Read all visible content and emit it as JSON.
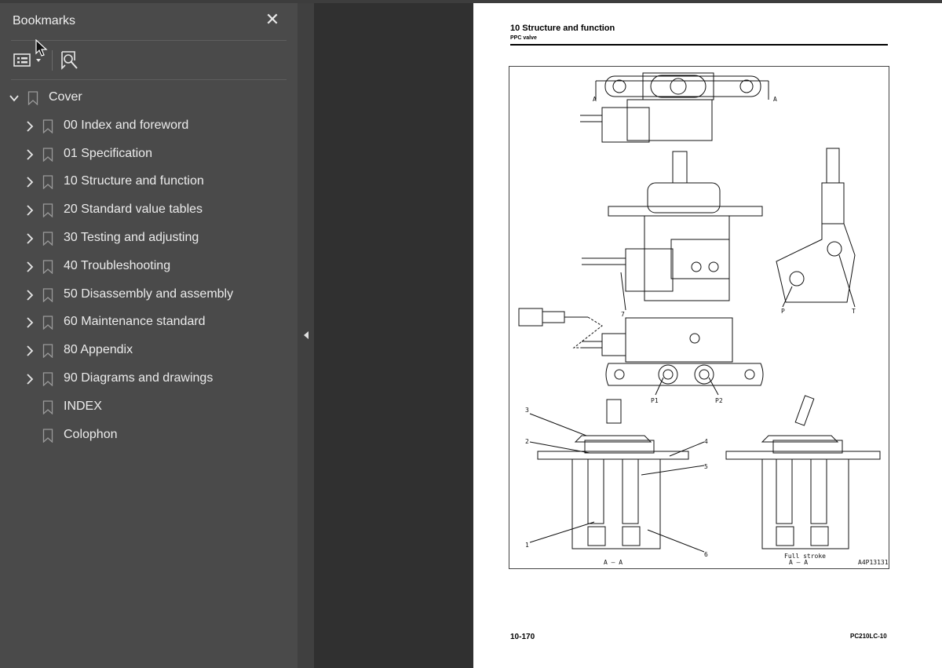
{
  "bookmarks_panel": {
    "title": "Bookmarks",
    "close_icon": "close-icon",
    "toolbar": {
      "options_icon": "list-options-icon",
      "find_icon": "bookmark-search-icon"
    },
    "items": [
      {
        "label": "Cover",
        "level": 0,
        "expanded": true,
        "has_children": true
      },
      {
        "label": "00 Index and foreword",
        "level": 1,
        "expanded": false,
        "has_children": true
      },
      {
        "label": "01 Specification",
        "level": 1,
        "expanded": false,
        "has_children": true
      },
      {
        "label": "10 Structure and function",
        "level": 1,
        "expanded": false,
        "has_children": true
      },
      {
        "label": "20 Standard value tables",
        "level": 1,
        "expanded": false,
        "has_children": true
      },
      {
        "label": "30 Testing and adjusting",
        "level": 1,
        "expanded": false,
        "has_children": true
      },
      {
        "label": "40 Troubleshooting",
        "level": 1,
        "expanded": false,
        "has_children": true
      },
      {
        "label": "50 Disassembly and assembly",
        "level": 1,
        "expanded": false,
        "has_children": true
      },
      {
        "label": "60 Maintenance standard",
        "level": 1,
        "expanded": false,
        "has_children": true
      },
      {
        "label": "80 Appendix",
        "level": 1,
        "expanded": false,
        "has_children": true
      },
      {
        "label": "90 Diagrams and drawings",
        "level": 1,
        "expanded": false,
        "has_children": true
      },
      {
        "label": "INDEX",
        "level": 1,
        "expanded": false,
        "has_children": false
      },
      {
        "label": "Colophon",
        "level": 1,
        "expanded": false,
        "has_children": false
      }
    ]
  },
  "document": {
    "heading": "10 Structure and function",
    "subheading": "PPC valve",
    "page_number": "10-170",
    "model_code": "PC210LC-10",
    "figure": {
      "section_marks": [
        "A",
        "A"
      ],
      "port_labels": [
        "P",
        "T",
        "P1",
        "P2"
      ],
      "callouts": [
        "1",
        "2",
        "3",
        "4",
        "5",
        "6",
        "7"
      ],
      "view_label_left": "A – A",
      "view_label_right": "A – A",
      "view_note_right": "Full stroke",
      "figure_code": "A4P13131"
    }
  },
  "colors": {
    "panel_bg": "#4a4a4a",
    "doc_bg": "#303030",
    "page_bg": "#ffffff",
    "text": "#ececec"
  }
}
